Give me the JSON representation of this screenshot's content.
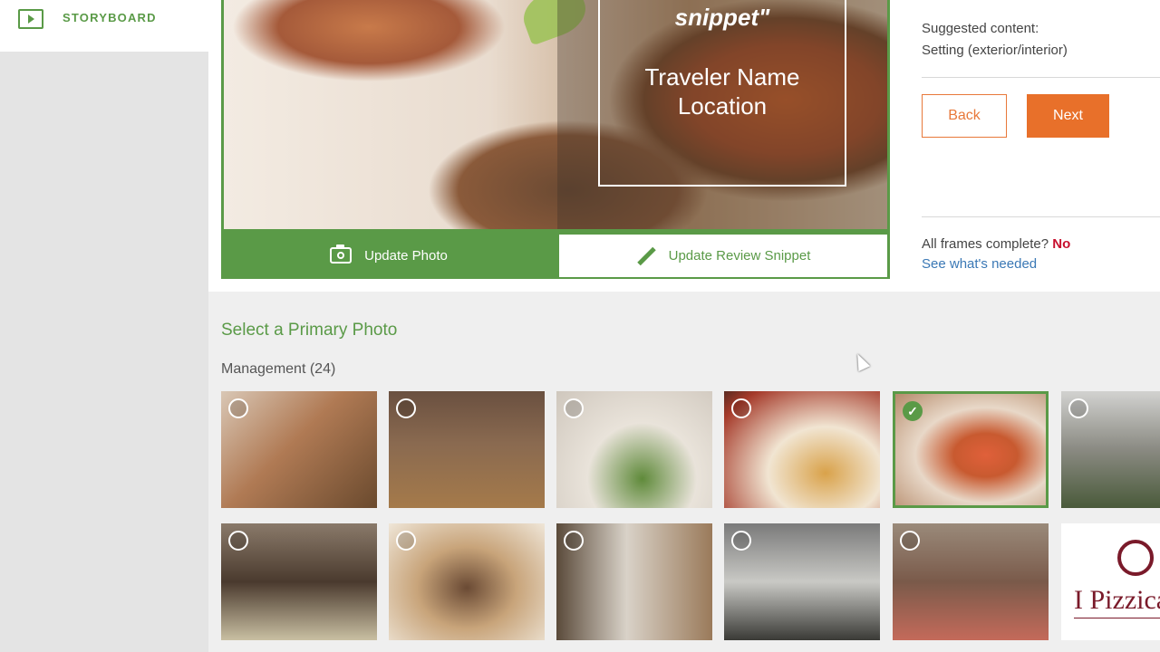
{
  "sidebar": {
    "storyboard_label": "STORYBOARD"
  },
  "preview": {
    "snippet_text": "snippet\"",
    "traveler_name": "Traveler Name",
    "location": "Location",
    "update_photo_label": "Update Photo",
    "update_snippet_label": "Update Review Snippet"
  },
  "right_panel": {
    "suggested_label": "Suggested content:",
    "suggested_value": "Setting (exterior/interior)",
    "back_label": "Back",
    "next_label": "Next",
    "frames_complete_label": "All frames complete?",
    "frames_complete_value": "No",
    "see_needed_link": "See what's needed"
  },
  "gallery": {
    "title": "Select a Primary Photo",
    "group_label": "Management (24)",
    "photos": [
      {
        "desc": "toast",
        "selected": false
      },
      {
        "desc": "bar",
        "selected": false
      },
      {
        "desc": "salad",
        "selected": false
      },
      {
        "desc": "pasta",
        "selected": false
      },
      {
        "desc": "bruschetta",
        "selected": true
      },
      {
        "desc": "terrace",
        "selected": false
      },
      {
        "desc": "cheese",
        "selected": false
      },
      {
        "desc": "tiramisu",
        "selected": false
      },
      {
        "desc": "entrance",
        "selected": false
      },
      {
        "desc": "counter",
        "selected": false
      },
      {
        "desc": "ham",
        "selected": false
      },
      {
        "desc": "logo",
        "selected": false,
        "logo_text": "I Pizzica"
      }
    ]
  },
  "colors": {
    "accent_green": "#5a9a47",
    "accent_orange": "#e8702a",
    "status_red": "#c8102e",
    "link_blue": "#3a78b5"
  }
}
